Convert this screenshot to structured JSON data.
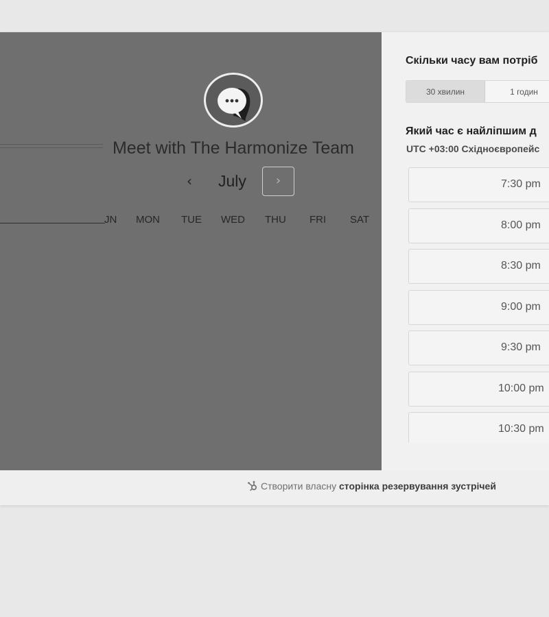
{
  "left_panel": {
    "title": "Meet with The Harmonize Team",
    "month": "July",
    "prev_month_icon": "‹",
    "next_month_icon": "›",
    "weekdays": [
      "JN",
      "MON",
      "TUE",
      "WED",
      "THU",
      "FRI",
      "SAT"
    ]
  },
  "right_panel": {
    "duration_question": "Скільки часу вам потріб",
    "duration_options": [
      "30 хвилин",
      "1 годин"
    ],
    "selected_duration": "30 хвилин",
    "time_question": "Який час є найліпшим д",
    "timezone": "UTC +03:00 Східноєвропейс",
    "time_slots": [
      "7:30 pm",
      "8:00 pm",
      "8:30 pm",
      "9:00 pm",
      "9:30 pm",
      "10:00 pm",
      "10:30 pm"
    ]
  },
  "footer": {
    "link_prefix": "Створити власну",
    "link_bold": "сторінка резервування зустрічей",
    "icon": "hubspot-icon"
  },
  "colors": {
    "left_panel_bg": "#6f6f6f",
    "right_panel_bg": "#f1f1f1",
    "page_bg": "#e8e8e8"
  }
}
